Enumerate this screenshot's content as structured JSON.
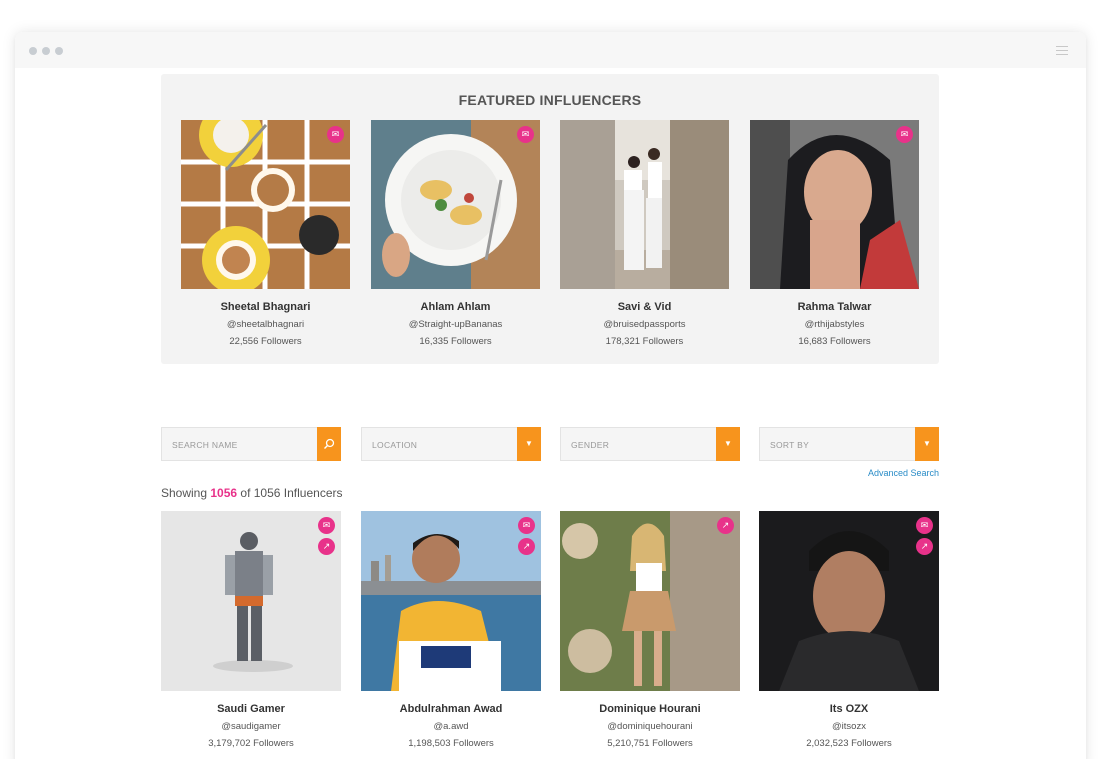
{
  "featured": {
    "title": "FEATURED INFLUENCERS",
    "influencers": [
      {
        "name": "Sheetal Bhagnari",
        "handle": "@sheetalbhagnari",
        "followers": "22,556 Followers"
      },
      {
        "name": "Ahlam Ahlam",
        "handle": "@Straight-upBananas",
        "followers": "16,335 Followers"
      },
      {
        "name": "Savi & Vid",
        "handle": "@bruisedpassports",
        "followers": "178,321 Followers"
      },
      {
        "name": "Rahma Talwar",
        "handle": "@rthijabstyles",
        "followers": "16,683 Followers"
      }
    ]
  },
  "filters": {
    "search_placeholder": "SEARCH NAME",
    "location_label": "LOCATION",
    "gender_label": "GENDER",
    "sort_label": "SORT BY",
    "advanced_search": "Advanced Search"
  },
  "results": {
    "prefix": "Showing ",
    "shown": "1056",
    "suffix": " of 1056 Influencers",
    "influencers": [
      {
        "name": "Saudi Gamer",
        "handle": "@saudigamer",
        "followers": "3,179,702 Followers"
      },
      {
        "name": "Abdulrahman Awad",
        "handle": "@a.awd",
        "followers": "1,198,503 Followers"
      },
      {
        "name": "Dominique Hourani",
        "handle": "@dominiquehourani",
        "followers": "5,210,751 Followers"
      },
      {
        "name": "Its OZX",
        "handle": "@itsozx",
        "followers": "2,032,523 Followers"
      }
    ]
  },
  "colors": {
    "accent_pink": "#e8328a",
    "accent_orange": "#f7941d",
    "link_blue": "#2a8cc7"
  },
  "icons": {
    "contact": "envelope-icon",
    "trending": "trending-up-icon",
    "search": "search-icon",
    "dropdown": "caret-down-icon"
  }
}
